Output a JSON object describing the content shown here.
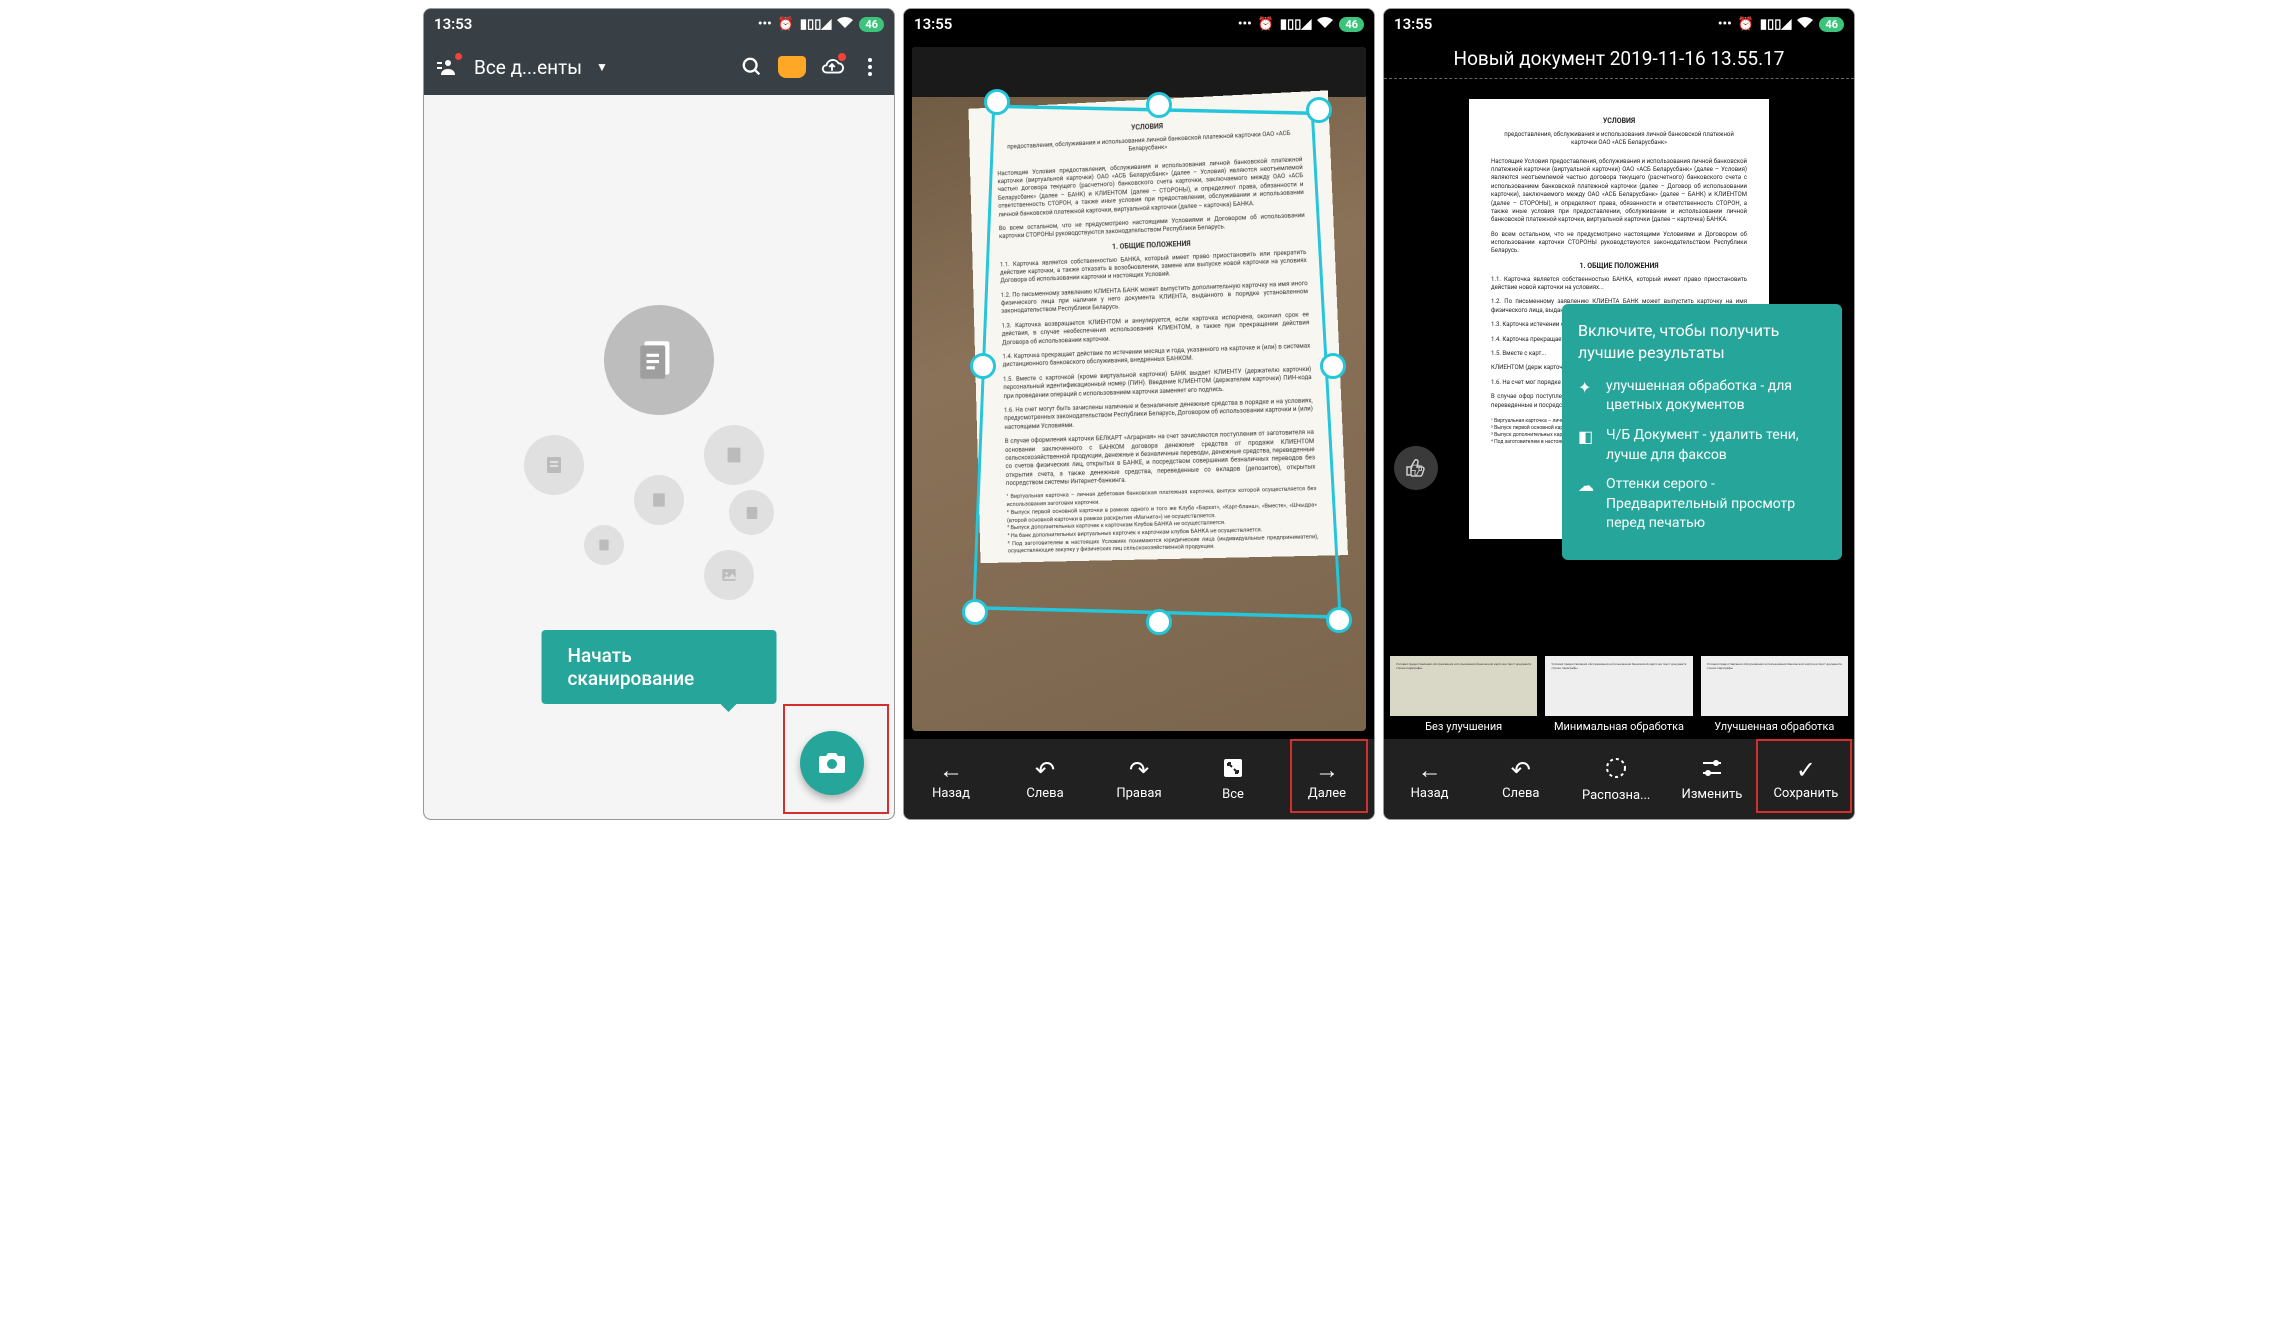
{
  "phone1": {
    "time": "13:53",
    "battery": "46",
    "appbar_title": "Все д...енты",
    "tooltip": "Начать сканирование"
  },
  "phone2": {
    "time": "13:55",
    "battery": "46",
    "doc_title": "УСЛОВИЯ",
    "doc_subtitle": "предоставления, обслуживания и использования личной банковской платежной карточки ОАО «АСБ Беларусбанк»",
    "buttons": {
      "back": "Назад",
      "left": "Слева",
      "right": "Правая",
      "all": "Все",
      "next": "Далее"
    }
  },
  "phone3": {
    "time": "13:55",
    "battery": "46",
    "title": "Новый документ 2019-11-16 13.55.17",
    "doc_title": "УСЛОВИЯ",
    "doc_subtitle": "предоставления, обслуживания и использования личной банковской платежной карточки ОАО «АСБ Беларусбанк»",
    "doc_section": "1. ОБЩИЕ ПОЛОЖЕНИЯ",
    "tooltip": {
      "title": "Включите, чтобы получить лучшие результаты",
      "item1": "улучшенная обработка - для цветных документов",
      "item2": "Ч/Б Документ - удалить тени, лучше для факсов",
      "item3": "Оттенки серого - Предварительный просмотр перед печатью"
    },
    "filters": {
      "none": "Без улучшения",
      "minimal": "Минимальная обработка",
      "enhanced": "Улучшенная обработка"
    },
    "buttons": {
      "back": "Назад",
      "left": "Слева",
      "recognize": "Распозна...",
      "edit": "Изменить",
      "save": "Сохранить"
    }
  }
}
